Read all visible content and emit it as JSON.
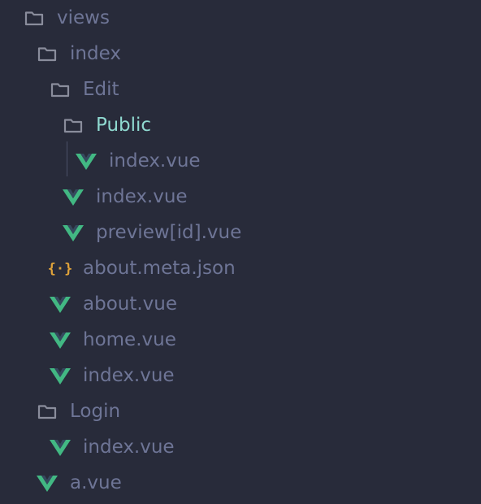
{
  "tree": {
    "items": [
      {
        "label": "views",
        "icon": "folder-icon",
        "depth": 0,
        "active": false
      },
      {
        "label": "index",
        "icon": "folder-icon",
        "depth": 1,
        "active": false
      },
      {
        "label": "Edit",
        "icon": "folder-icon",
        "depth": 2,
        "active": false
      },
      {
        "label": "Public",
        "icon": "folder-icon",
        "depth": 3,
        "active": true
      },
      {
        "label": "index.vue",
        "icon": "vue-file-icon",
        "depth": 4,
        "active": false
      },
      {
        "label": "index.vue",
        "icon": "vue-file-icon",
        "depth": 3,
        "active": false
      },
      {
        "label": "preview[id].vue",
        "icon": "vue-file-icon",
        "depth": 3,
        "active": false
      },
      {
        "label": "about.meta.json",
        "icon": "json-file-icon",
        "depth": 2,
        "active": false
      },
      {
        "label": "about.vue",
        "icon": "vue-file-icon",
        "depth": 2,
        "active": false
      },
      {
        "label": "home.vue",
        "icon": "vue-file-icon",
        "depth": 2,
        "active": false
      },
      {
        "label": "index.vue",
        "icon": "vue-file-icon",
        "depth": 2,
        "active": false
      },
      {
        "label": "Login",
        "icon": "folder-icon",
        "depth": 1,
        "active": false
      },
      {
        "label": "index.vue",
        "icon": "vue-file-icon",
        "depth": 2,
        "active": false
      },
      {
        "label": "a.vue",
        "icon": "vue-file-icon",
        "depth": 1,
        "active": false
      }
    ]
  },
  "colors": {
    "background": "#282b3a",
    "text": "#6e7596",
    "active_text": "#8fd9d0",
    "folder": "#8a8d9c",
    "vue": "#42b883",
    "json": "#e0a33a"
  }
}
